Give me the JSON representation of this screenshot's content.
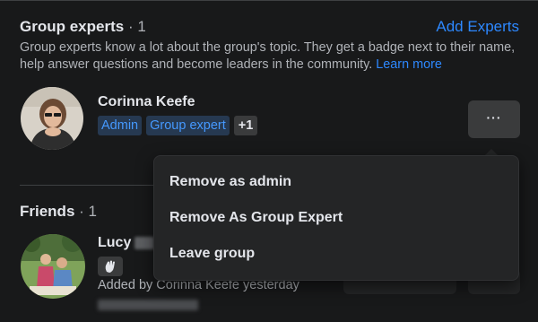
{
  "experts_section": {
    "title": "Group experts",
    "count": "· 1",
    "add_experts_label": "Add Experts",
    "description": "Group experts know a lot about the group's topic. They get a badge next to their name, help answer questions and become leaders in the community.",
    "learn_more_label": "Learn more"
  },
  "expert_member": {
    "name": "Corinna Keefe",
    "badges": [
      "Admin",
      "Group expert",
      "+1"
    ],
    "more_label": "···"
  },
  "menu": {
    "items": [
      "Remove as admin",
      "Remove As Group Expert",
      "Leave group"
    ]
  },
  "friends_section": {
    "title": "Friends",
    "count": "· 1"
  },
  "friend_member": {
    "name": "Lucy",
    "added_text": "Added by Corinna Keefe yesterday"
  },
  "colors": {
    "background": "#18191a",
    "link_blue": "#2d88ff",
    "menu_background": "#242526",
    "button_gray": "#3a3b3c"
  },
  "icons": {
    "more": "more-dots-icon",
    "wave": "wave-hand-icon"
  }
}
